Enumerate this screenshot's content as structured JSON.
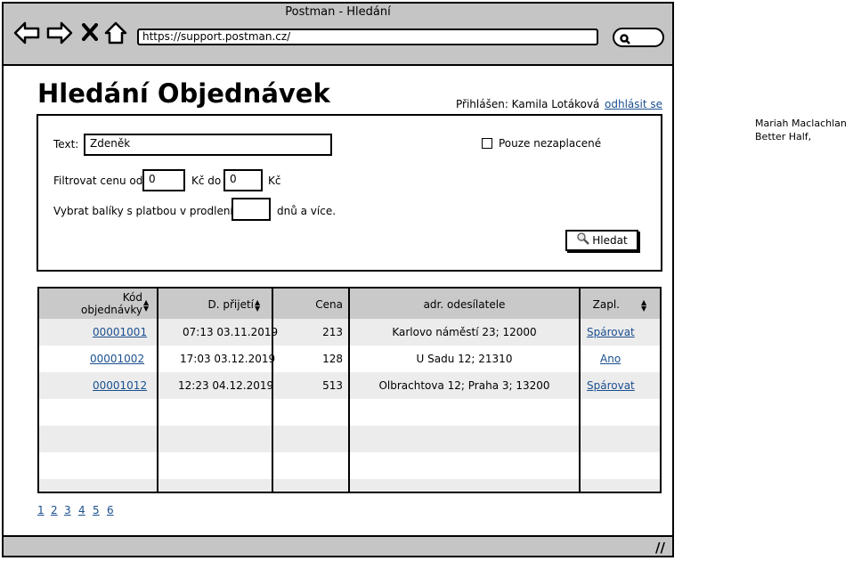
{
  "window": {
    "title": "Postman - Hledání",
    "url": "https://support.postman.cz/"
  },
  "nav": {
    "back_icon": "arrow-left-icon",
    "forward_icon": "arrow-right-icon",
    "close_icon": "x-icon",
    "home_icon": "home-icon",
    "search_icon": "search-icon"
  },
  "page": {
    "title": "Hledání Objednávek",
    "login_label": "Přihlášen: Kamila Lotáková",
    "logout_label": "odhlásit se"
  },
  "filters": {
    "text_label": "Text:",
    "text_value": "Zdeněk",
    "unpaid_label": "Pouze nezaplacené",
    "unpaid_checked": false,
    "price_from_label": "Filtrovat cenu od:",
    "price_from_value": "0",
    "currency_to_label": "Kč do",
    "price_to_value": "0",
    "currency_label": "Kč",
    "overdue_label": "Vybrat balíky s platbou v prodlení",
    "overdue_value": "",
    "overdue_suffix": "dnů a více.",
    "search_button": "Hledat"
  },
  "table": {
    "headers": {
      "code_line1": "Kód",
      "code_line2": "objednávky",
      "received": "D. přijetí",
      "price": "Cena",
      "address": "adr. odesílatele",
      "paid": "Zapl."
    },
    "rows": [
      {
        "code": "00001001",
        "received": "07:13 03.11.2019",
        "price": "213",
        "address": "Karlovo náměstí 23; 12000",
        "paid": "Spárovat"
      },
      {
        "code": "00001002",
        "received": "17:03 03.12.2019",
        "price": "128",
        "address": "U Sadu 12; 21310",
        "paid": "Ano"
      },
      {
        "code": "00001012",
        "received": "12:23 04.12.2019",
        "price": "513",
        "address": "Olbrachtova 12; Praha 3; 13200",
        "paid": "Spárovat"
      }
    ]
  },
  "pagination": [
    "1",
    "2",
    "3",
    "4",
    "5",
    "6"
  ],
  "side_note": {
    "line1": "Mariah Maclachlan",
    "line2": "Better Half,"
  },
  "colors": {
    "chrome": "#c5c5c5",
    "header": "#c9c9c9",
    "stripe": "#ececec",
    "link": "#1a4f8f"
  }
}
